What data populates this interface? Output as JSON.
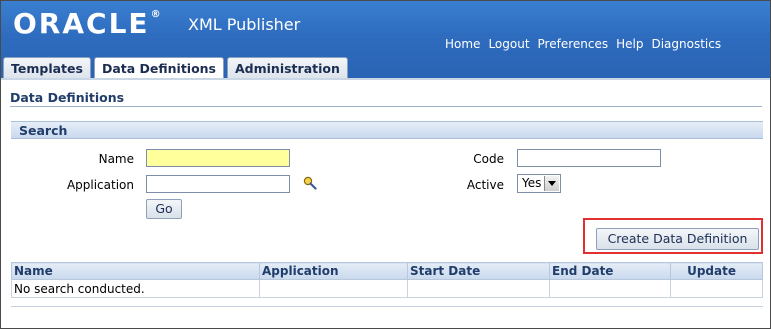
{
  "branding": {
    "logo": "ORACLE",
    "registered": "®",
    "product": "XML Publisher"
  },
  "global_links": [
    "Home",
    "Logout",
    "Preferences",
    "Help",
    "Diagnostics"
  ],
  "tabs": [
    {
      "label": "Templates",
      "active": false
    },
    {
      "label": "Data Definitions",
      "active": true
    },
    {
      "label": "Administration",
      "active": false
    }
  ],
  "page": {
    "title": "Data Definitions"
  },
  "search": {
    "header": "Search",
    "name_label": "Name",
    "name_value": "",
    "application_label": "Application",
    "application_value": "",
    "code_label": "Code",
    "code_value": "",
    "active_label": "Active",
    "active_value": "Yes",
    "go_label": "Go"
  },
  "actions": {
    "create_label": "Create Data Definition"
  },
  "results": {
    "columns": [
      "Name",
      "Application",
      "Start Date",
      "End Date",
      "Update"
    ],
    "empty_message": "No search conducted."
  },
  "colors": {
    "header": "#2e6cbf",
    "required_field": "#ffff9c",
    "highlight": "#e03030"
  },
  "icons": {
    "lov": "search-flashlight-icon",
    "dropdown": "chevron-down-icon"
  }
}
